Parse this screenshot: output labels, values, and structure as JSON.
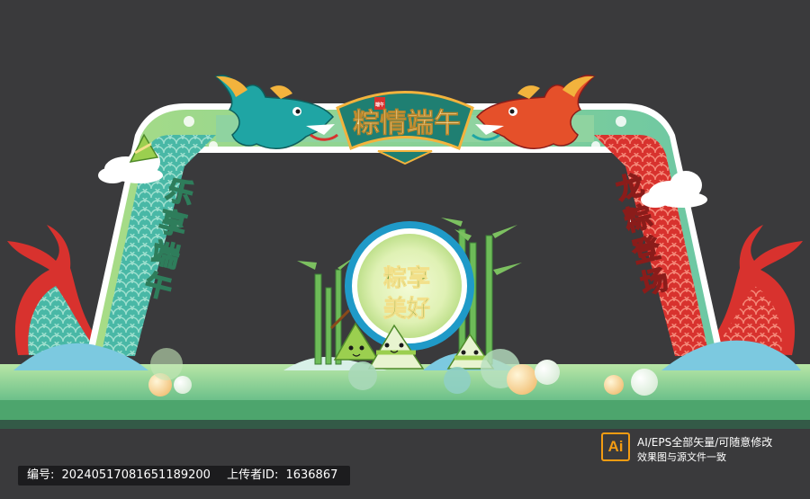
{
  "banner": {
    "title": "粽情端午",
    "seal": "端午"
  },
  "pillars": {
    "left_text": [
      "乐",
      "享",
      "端",
      "午"
    ],
    "right_text": [
      "龙",
      "粽",
      "登",
      "场"
    ]
  },
  "center_medallion": {
    "line1": "粽享",
    "line2": "美好"
  },
  "colors": {
    "background": "#3a3a3c",
    "teal": "#1f9a8c",
    "red": "#d8322e",
    "gold": "#f2b33d",
    "light_green": "#bfe08c",
    "ground_green": "#8fd08a"
  },
  "file_info": {
    "icon_label": "Ai",
    "line1": "AI/EPS全部矢量/可随意修改",
    "line2": "效果图与源文件一致"
  },
  "footer": {
    "id_label": "编号:",
    "id_value": "20240517081651189200",
    "uploader_label": "上传者ID:",
    "uploader_value": "1636867"
  }
}
